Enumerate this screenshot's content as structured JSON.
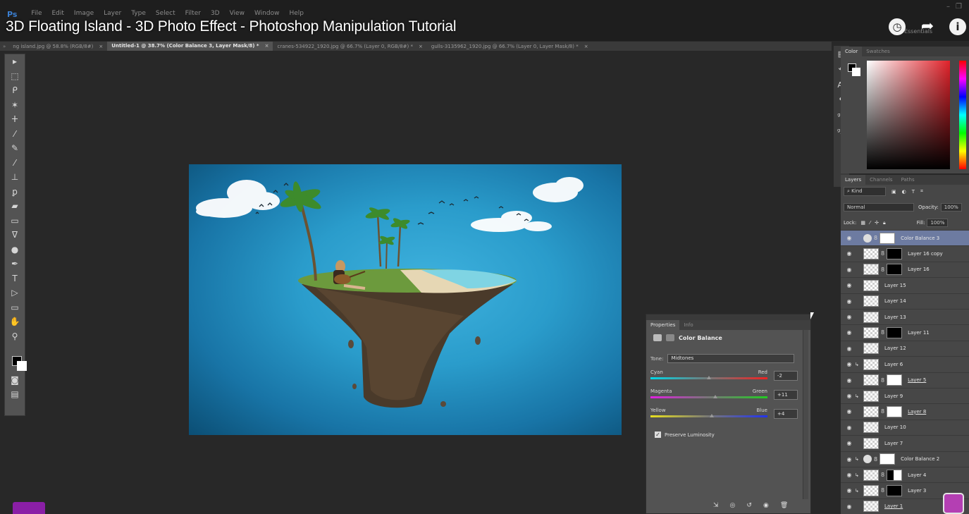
{
  "menu": {
    "logo": "Ps",
    "items": [
      "File",
      "Edit",
      "Image",
      "Layer",
      "Type",
      "Select",
      "Filter",
      "3D",
      "View",
      "Window",
      "Help"
    ]
  },
  "video": {
    "title": "3D Floating Island - 3D Photo Effect - Photoshop Manipulation Tutorial",
    "workspace_label": "Essentials",
    "icons": [
      "clock-icon",
      "share-icon",
      "info-icon"
    ]
  },
  "tabs": [
    {
      "label": "ng island.jpg @ 58.8% (RGB/8#)",
      "active": false
    },
    {
      "label": "Untitled-1 @ 38.7% (Color Balance 3, Layer Mask/8) *",
      "active": true
    },
    {
      "label": "cranes-534922_1920.jpg @ 66.7% (Layer 0, RGB/8#) *",
      "active": false
    },
    {
      "label": "gulls-3135962_1920.jpg @ 66.7% (Layer 0, Layer Mask/8) *",
      "active": false
    }
  ],
  "tools": [
    "move-tool-icon",
    "marquee-tool-icon",
    "lasso-tool-icon",
    "magic-wand-tool-icon",
    "crop-tool-icon",
    "eyedropper-tool-icon",
    "healing-brush-tool-icon",
    "brush-tool-icon",
    "clone-stamp-tool-icon",
    "history-brush-tool-icon",
    "eraser-tool-icon",
    "gradient-tool-icon",
    "blur-tool-icon",
    "dodge-tool-icon",
    "pen-tool-icon",
    "type-tool-icon",
    "path-selection-tool-icon",
    "rectangle-tool-icon",
    "hand-tool-icon",
    "zoom-tool-icon"
  ],
  "tool_glyphs": [
    "▸",
    "⬚",
    "ᑭ",
    "✶",
    "ⵜ",
    "⁄",
    "✎",
    "⁄",
    "⊥",
    "ꝑ",
    "▰",
    "▭",
    "ᐁ",
    "●",
    "✒",
    "T",
    "▷",
    "▭",
    "✋",
    "⚲"
  ],
  "icon_strip": [
    "A|",
    "¶",
    "ᵍ¶",
    "ᵍA"
  ],
  "color_panel": {
    "tabs": [
      "Color",
      "Swatches"
    ],
    "fg": "#000000",
    "bg": "#ffffff",
    "hue": "#e1222a"
  },
  "layers_panel": {
    "tabs": [
      "Layers",
      "Channels",
      "Paths"
    ],
    "filter_label": "Kind",
    "blend_mode": "Normal",
    "opacity_label": "Opacity:",
    "opacity_value": "100%",
    "lock_label": "Lock:",
    "fill_label": "Fill:",
    "fill_value": "100%",
    "layers": [
      {
        "name": "Color Balance 3",
        "selected": true
      },
      {
        "name": "Layer 16 copy",
        "selected": false
      },
      {
        "name": "Layer 16",
        "selected": false
      },
      {
        "name": "Layer 15",
        "selected": false
      },
      {
        "name": "Layer 14",
        "selected": false
      },
      {
        "name": "Layer 13",
        "selected": false
      },
      {
        "name": "Layer 11",
        "selected": false
      },
      {
        "name": "Layer 12",
        "selected": false
      },
      {
        "name": "Layer 6",
        "selected": false
      },
      {
        "name": "Layer 5",
        "selected": false
      },
      {
        "name": "Layer 9",
        "selected": false
      },
      {
        "name": "Layer 8",
        "selected": false
      },
      {
        "name": "Layer 10",
        "selected": false
      },
      {
        "name": "Layer 7",
        "selected": false
      },
      {
        "name": "Color Balance 2",
        "selected": false
      },
      {
        "name": "Layer 4",
        "selected": false
      },
      {
        "name": "Layer 3",
        "selected": false
      },
      {
        "name": "Layer 1",
        "selected": false
      }
    ]
  },
  "properties": {
    "tabs": [
      "Properties",
      "Info"
    ],
    "title": "Color Balance",
    "tone_label": "Tone:",
    "tone_value": "Midtones",
    "sliders": [
      {
        "left": "Cyan",
        "right": "Red",
        "value": "-2"
      },
      {
        "left": "Magenta",
        "right": "Green",
        "value": "+11"
      },
      {
        "left": "Yellow",
        "right": "Blue",
        "value": "+4"
      }
    ],
    "preserve_luminosity": "Preserve Luminosity"
  }
}
